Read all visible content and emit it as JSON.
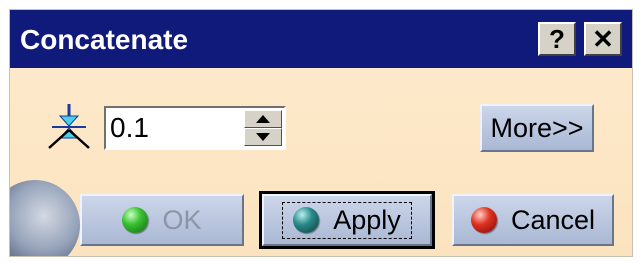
{
  "dialog": {
    "title": "Concatenate",
    "help_label": "?",
    "close_label": "✕"
  },
  "tolerance": {
    "value": "0.1",
    "icon": "tolerance-icon"
  },
  "buttons": {
    "more_label": "More>>",
    "ok_label": "OK",
    "apply_label": "Apply",
    "cancel_label": "Cancel"
  },
  "colors": {
    "titlebar": "#101a7a",
    "background": "#fbe7c8",
    "ok_led": "#38c030",
    "apply_led": "#2a8a8a",
    "cancel_led": "#e03020"
  }
}
